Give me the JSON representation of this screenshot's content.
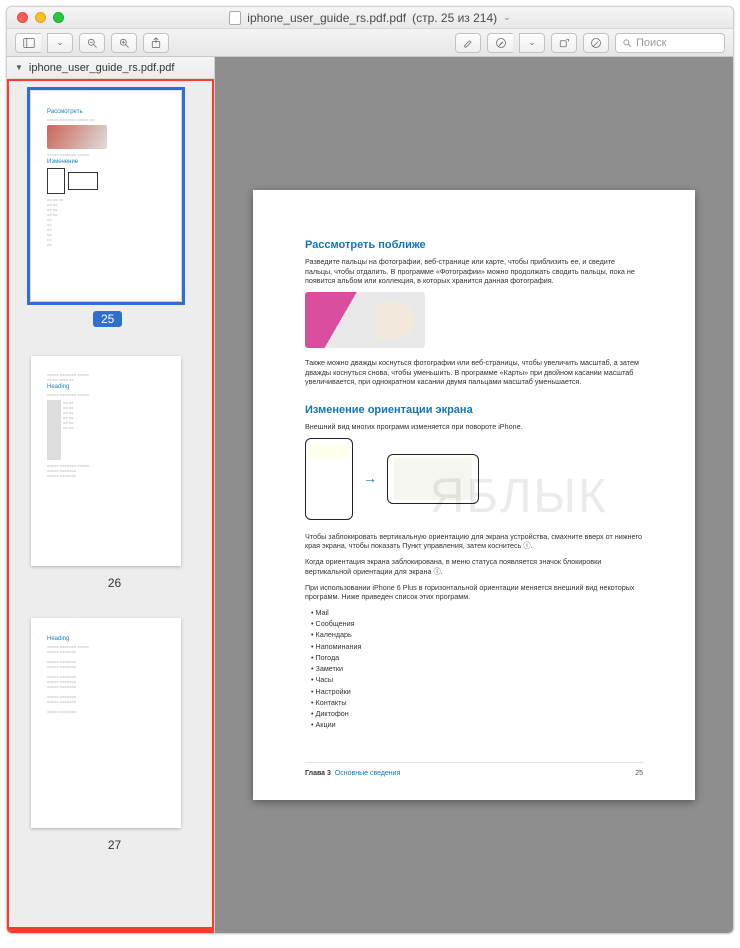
{
  "window": {
    "title_file": "iphone_user_guide_rs.pdf.pdf",
    "title_page_info": "(стр. 25 из 214)"
  },
  "toolbar": {
    "search_placeholder": "Поиск"
  },
  "sidebar": {
    "file_label": "iphone_user_guide_rs.pdf.pdf",
    "selected_page": "25",
    "thumbs": [
      {
        "num": "25",
        "selected": true
      },
      {
        "num": "26",
        "selected": false
      },
      {
        "num": "27",
        "selected": false
      }
    ]
  },
  "page": {
    "heading1": "Рассмотреть поближе",
    "p1": "Разведите пальцы на фотографии, веб-странице или карте, чтобы приблизить ее, и сведите пальцы, чтобы отдалить. В программе «Фотографии» можно продолжать сводить пальцы, пока не появится альбом или коллекция, в которых хранится данная фотография.",
    "p2": "Также можно дважды коснуться фотографии или веб-страницы, чтобы увеличить масштаб, а затем дважды коснуться снова, чтобы уменьшить. В программе «Карты» при двойном касании масштаб увеличивается, при однократном касании двумя пальцами масштаб уменьшается.",
    "heading2": "Изменение ориентации экрана",
    "p3": "Внешний вид многих программ изменяется при повороте iPhone.",
    "p4": "Чтобы заблокировать вертикальную ориентацию для экрана устройства, смахните вверх от нижнего края экрана, чтобы показать Пункт управления, затем коснитесь ⓘ.",
    "p5": "Когда ориентация экрана заблокирована, в меню статуса появляется значок блокировки вертикальной ориентации для экрана ⓘ.",
    "p6": "При использовании iPhone 6 Plus в горизонтальной ориентации меняется внешний вид некоторых программ. Ниже приведен список этих программ.",
    "list": [
      "Mail",
      "Сообщения",
      "Календарь",
      "Напоминания",
      "Погода",
      "Заметки",
      "Часы",
      "Настройки",
      "Контакты",
      "Диктофон",
      "Акции"
    ],
    "footer_chapter": "Глава 3",
    "footer_section": "Основные сведения",
    "footer_pagenum": "25",
    "watermark": "ЯБЛЫК"
  }
}
